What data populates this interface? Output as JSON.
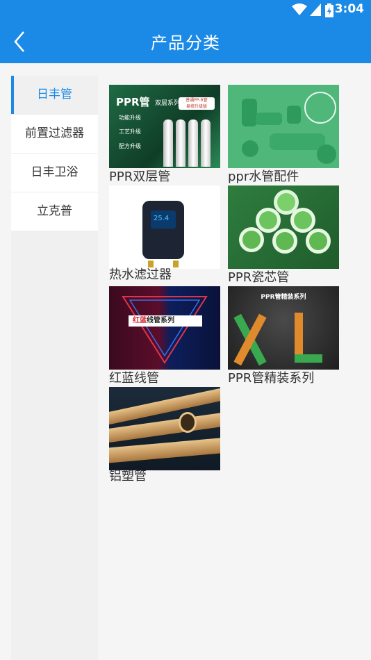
{
  "status": {
    "time": "3:04"
  },
  "header": {
    "title": "产品分类"
  },
  "sidebar": {
    "items": [
      {
        "label": "日丰管",
        "active": true
      },
      {
        "label": "前置过滤器",
        "active": false
      },
      {
        "label": "日丰卫浴",
        "active": false
      },
      {
        "label": "立克普",
        "active": false
      }
    ]
  },
  "products": [
    {
      "label": "PPR双层管",
      "image_text": [
        "PPR管",
        "双层系列",
        "普通PP-R管",
        "易修升级版",
        "功能升级",
        "工艺升级",
        "配方升级"
      ]
    },
    {
      "label": "ppr水管配件"
    },
    {
      "label": "热水滤过器"
    },
    {
      "label": "PPR瓷芯管"
    },
    {
      "label": "红蓝线管",
      "image_text": [
        "红蓝",
        "线管系列"
      ]
    },
    {
      "label": "PPR管精装系列",
      "image_text": [
        "PPR管",
        "精装系列",
        "XL"
      ]
    },
    {
      "label": "铝塑管"
    }
  ]
}
